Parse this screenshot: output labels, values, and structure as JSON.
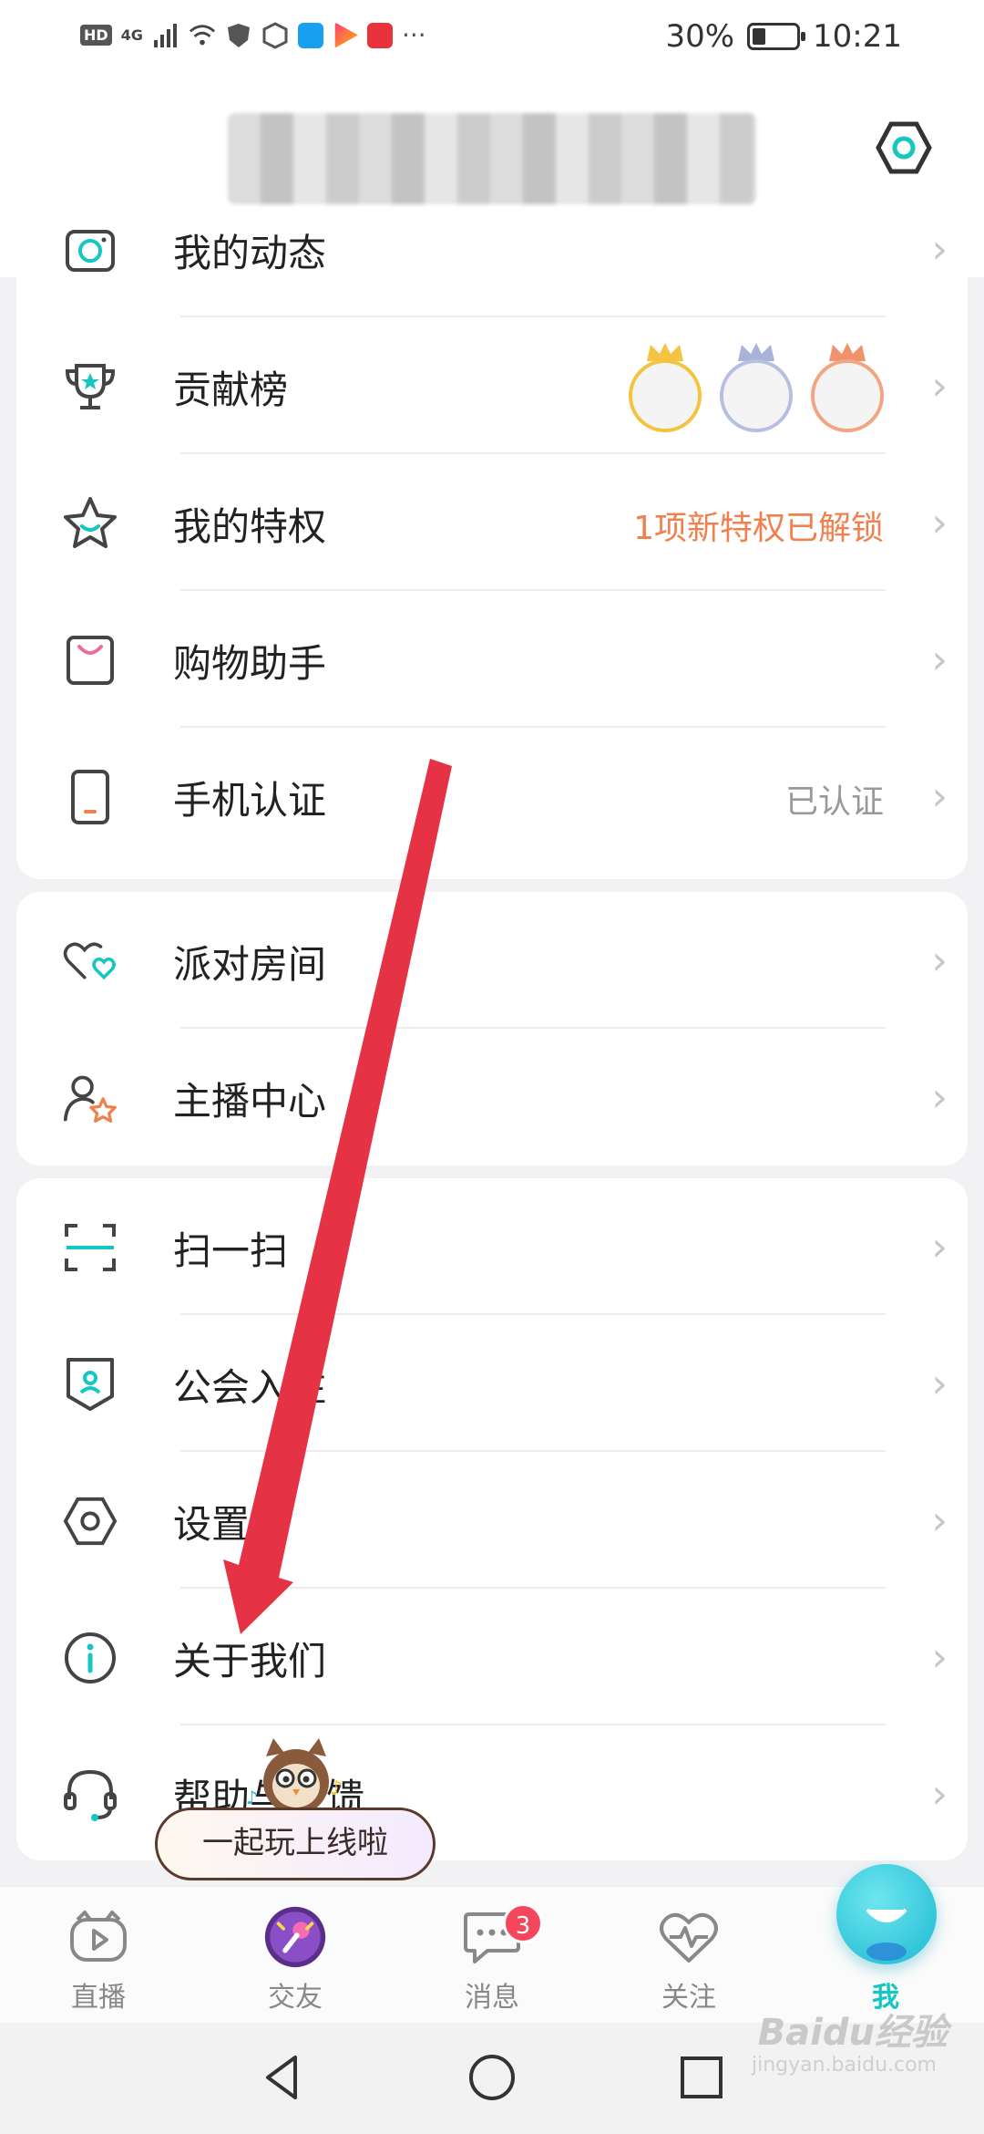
{
  "status_bar": {
    "battery": "30%",
    "battery_level": 0.3,
    "time": "10:21",
    "network": "4G",
    "hd_label": "HD"
  },
  "header": {
    "settings_icon": "hexagon-settings-icon"
  },
  "menu_group_1": [
    {
      "label": "我的动态",
      "icon": "camera-icon"
    },
    {
      "label": "贡献榜",
      "icon": "trophy-icon"
    },
    {
      "label": "我的特权",
      "icon": "star-icon",
      "value": "1项新特权已解锁"
    },
    {
      "label": "购物助手",
      "icon": "shopping-bag-icon"
    },
    {
      "label": "手机认证",
      "icon": "phone-icon",
      "value": "已认证"
    }
  ],
  "menu_group_2": [
    {
      "label": "派对房间",
      "icon": "hearts-icon"
    },
    {
      "label": "主播中心",
      "icon": "streamer-star-icon"
    }
  ],
  "menu_group_3": [
    {
      "label": "扫一扫",
      "icon": "scan-icon"
    },
    {
      "label": "公会入驻",
      "icon": "guild-badge-icon"
    },
    {
      "label": "设置",
      "icon": "settings-hexagon-icon"
    },
    {
      "label": "关于我们",
      "icon": "info-icon"
    },
    {
      "label": "帮助与反馈",
      "icon": "headset-icon"
    }
  ],
  "promo": {
    "label": "一起玩上线啦"
  },
  "tabbar": [
    {
      "label": "直播",
      "icon": "live-tv-icon"
    },
    {
      "label": "交友",
      "icon": "microphone-icon"
    },
    {
      "label": "消息",
      "icon": "chat-icon",
      "badge": "3"
    },
    {
      "label": "关注",
      "icon": "heartbeat-icon"
    },
    {
      "label": "我",
      "icon": "me-face-icon"
    }
  ],
  "watermark": {
    "brand": "Baidu经验",
    "url": "jingyan.baidu.com"
  },
  "colors": {
    "accent": "#15c6c1",
    "orange": "#f0804d",
    "arrow": "#e53345",
    "badge": "#f5475c"
  }
}
